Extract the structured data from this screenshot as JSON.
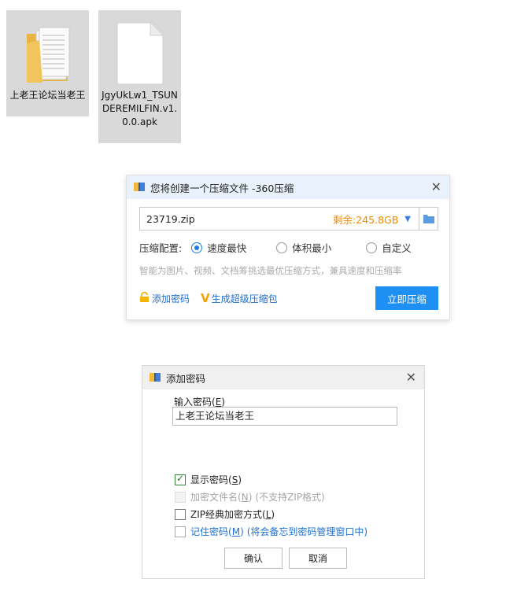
{
  "desktop": {
    "folder_label": "上老王论坛当老王",
    "apk_label": "JgyUkLw1_TSUNDEREMILFIN.v1.0.0.apk"
  },
  "zip_dialog": {
    "title": "您将创建一个压缩文件 -360压缩",
    "filename": "23719.zip",
    "free_space": "剩余:245.8GB",
    "config_label": "压缩配置:",
    "options": [
      "速度最快",
      "体积最小",
      "自定义"
    ],
    "selected_option": "速度最快",
    "hint": "智能为图片、视频、文档筹挑选最优压缩方式，兼具速度和压缩率",
    "add_password": "添加密码",
    "super_zip": "生成超级压缩包",
    "compress_button": "立即压缩",
    "accent_color": "#1e90f3"
  },
  "password_dialog": {
    "title": "添加密码",
    "input_label": "输入密码",
    "input_label_key": "E",
    "password_value": "上老王论坛当老王",
    "show_password": "显示密码",
    "show_password_key": "S",
    "show_password_checked": true,
    "encrypt_names": "加密文件名",
    "encrypt_names_key": "N",
    "encrypt_names_note": "(不支持ZIP格式)",
    "zip_classic": "ZIP经典加密方式",
    "zip_classic_key": "L",
    "remember": "记住密码",
    "remember_key": "M",
    "remember_note": "(将会备忘到密码管理窗口中)",
    "ok_button": "确认",
    "cancel_button": "取消"
  }
}
